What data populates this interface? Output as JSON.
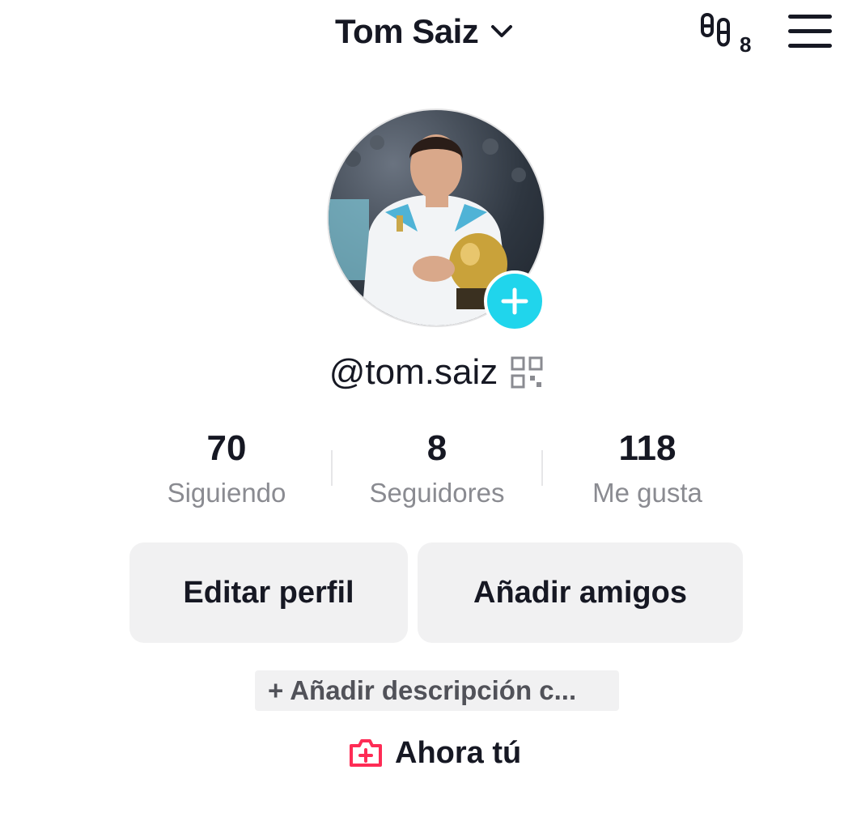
{
  "header": {
    "account_name": "Tom Saiz",
    "chevron_icon": "chevron-down-icon",
    "creator_icon": "footprints-icon",
    "creator_count": "8",
    "menu_icon": "hamburger-menu-icon"
  },
  "profile": {
    "avatar_icon": "profile-photo",
    "add_avatar_icon": "plus-icon",
    "handle": "@tom.saiz",
    "qr_icon": "qr-code-icon"
  },
  "stats": [
    {
      "value": "70",
      "label": "Siguiendo"
    },
    {
      "value": "8",
      "label": "Seguidores"
    },
    {
      "value": "118",
      "label": "Me gusta"
    }
  ],
  "actions": {
    "edit_profile": "Editar perfil",
    "add_friends": "Añadir amigos"
  },
  "bio": {
    "add_description": "+ Añadir descripción c..."
  },
  "now": {
    "icon": "camera-plus-icon",
    "label": "Ahora tú"
  },
  "colors": {
    "accent_cyan": "#20d5ec",
    "accent_pink": "#fe2c55",
    "button_bg": "#f1f1f2",
    "text_primary": "#161823",
    "text_secondary": "#8a8b91"
  }
}
